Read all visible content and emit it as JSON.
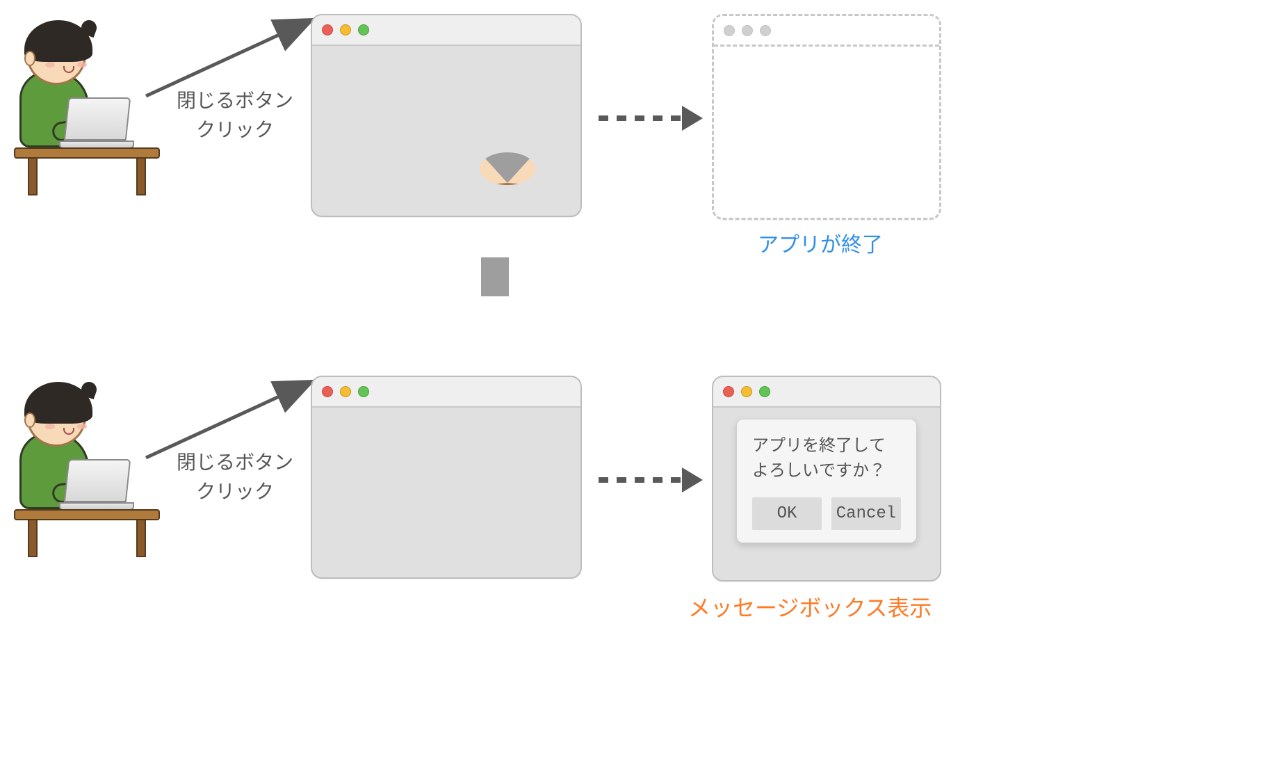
{
  "rows": {
    "top": {
      "action_label_line1": "閉じるボタン",
      "action_label_line2": "クリック",
      "result_label": "アプリが終了"
    },
    "bottom": {
      "action_label_line1": "閉じるボタン",
      "action_label_line2": "クリック",
      "result_label": "メッセージボックス表示"
    }
  },
  "dialog": {
    "message_line1": "アプリを終了して",
    "message_line2": "よろしいですか？",
    "ok_label": "OK",
    "cancel_label": "Cancel"
  },
  "icons": {
    "close": "close-icon",
    "minimize": "minimize-icon",
    "zoom": "zoom-icon"
  }
}
